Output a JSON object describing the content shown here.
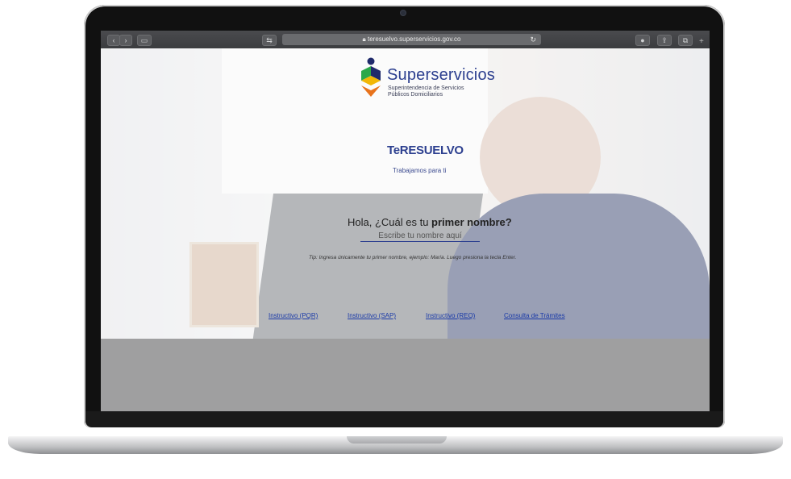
{
  "browser": {
    "url": "teresuelvo.superservicios.gov.co",
    "lock_icon": "lock-icon",
    "reload_icon": "reload-icon"
  },
  "logo": {
    "wordmark": "Superservicios",
    "subtitle_line1": "Superintendencia de Servicios",
    "subtitle_line2": "Públicos Domiciliarios"
  },
  "brand": {
    "name": "TeRESUELVO",
    "tagline": "Trabajamos para ti"
  },
  "form": {
    "question_prefix": "Hola, ¿Cuál es tu ",
    "question_bold": "primer nombre?",
    "placeholder": "Escribe tu nombre aquí",
    "tip": "Tip: Ingresa únicamente tu primer nombre, ejemplo: María. Luego presiona la tecla Enter."
  },
  "links": [
    {
      "label": "Instructivo (PQR)"
    },
    {
      "label": "Instructivo (SAP)"
    },
    {
      "label": "Instructivo (REQ)"
    },
    {
      "label": "Consulta de Trámites"
    }
  ],
  "colors": {
    "brand_blue": "#2c3f8f",
    "link": "#1a3aa8",
    "logo_yellow": "#f2b705",
    "logo_orange": "#e8731c",
    "logo_green": "#2aa84a",
    "logo_navy": "#1f2a6b"
  }
}
